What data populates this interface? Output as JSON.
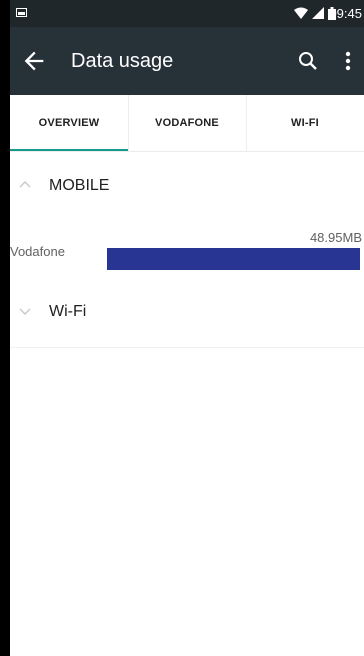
{
  "status_bar": {
    "time": "09:45",
    "icons": [
      "image-notification-icon",
      "wifi-icon",
      "cell-signal-icon",
      "battery-icon"
    ]
  },
  "app_bar": {
    "title": "Data usage",
    "back_icon": "arrow-back-icon",
    "search_icon": "search-icon",
    "more_icon": "more-vert-icon"
  },
  "tabs": [
    {
      "label": "OVERVIEW",
      "selected": true
    },
    {
      "label": "VODAFONE",
      "selected": false
    },
    {
      "label": "WI-FI",
      "selected": false
    }
  ],
  "sections": {
    "mobile": {
      "label": "MOBILE",
      "expanded": true
    },
    "wifi": {
      "label": "Wi-Fi",
      "expanded": false
    }
  },
  "usage": [
    {
      "carrier": "Vodafone",
      "amount": "48.95MB",
      "fraction": 1.0
    }
  ],
  "colors": {
    "status_bar": "#1f272b",
    "app_bar": "#263238",
    "tab_indicator": "#159a8c",
    "usage_bar": "#283593"
  }
}
